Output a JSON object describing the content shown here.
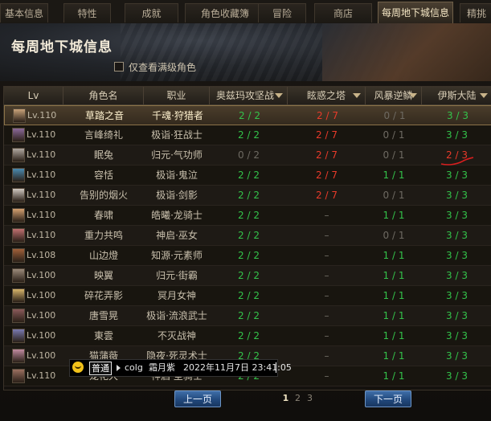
{
  "tabs": [
    {
      "label": "基本信息",
      "active": false
    },
    {
      "label": "特性",
      "active": false
    },
    {
      "label": "成就",
      "active": false
    },
    {
      "label": "角色收藏簿",
      "active": false
    },
    {
      "label": "冒险",
      "active": false
    },
    {
      "label": "商店",
      "active": false
    },
    {
      "label": "每周地下城信息",
      "active": true
    },
    {
      "label": "精挑",
      "active": false
    }
  ],
  "header": {
    "title": "每周地下城信息",
    "checkbox_label": "仅查看满级角色",
    "checkbox_checked": false
  },
  "table": {
    "columns": [
      "Lv",
      "角色名",
      "职业",
      "奥兹玛攻坚战",
      "眩惑之塔",
      "风暴逆鳞",
      "伊斯大陆"
    ],
    "sortable_columns": [
      3,
      4,
      5,
      6
    ],
    "rows": [
      {
        "lv": "Lv.110",
        "name": "草踏之音",
        "job": "千魂·狩猎者",
        "a": "2 / 2",
        "b": "2 / 7",
        "c": "0 / 1",
        "d": "3 / 3",
        "ac": "green",
        "bc": "red",
        "cc": "gray",
        "dc": "green",
        "selected": true
      },
      {
        "lv": "Lv.110",
        "name": "言峰绮礼",
        "job": "极诣·狂战士",
        "a": "2 / 2",
        "b": "2 / 7",
        "c": "0 / 1",
        "d": "3 / 3",
        "ac": "green",
        "bc": "red",
        "cc": "gray",
        "dc": "green",
        "selected": false
      },
      {
        "lv": "Lv.110",
        "name": "眠兔",
        "job": "归元·气功师",
        "a": "0 / 2",
        "b": "2 / 7",
        "c": "0 / 1",
        "d": "2 / 3",
        "ac": "gray",
        "bc": "red",
        "cc": "gray",
        "dc": "red",
        "selected": false
      },
      {
        "lv": "Lv.110",
        "name": "容恬",
        "job": "极诣·鬼泣",
        "a": "2 / 2",
        "b": "2 / 7",
        "c": "1 / 1",
        "d": "3 / 3",
        "ac": "green",
        "bc": "red",
        "cc": "green",
        "dc": "green",
        "selected": false
      },
      {
        "lv": "Lv.110",
        "name": "告别的烟火",
        "job": "极诣·剑影",
        "a": "2 / 2",
        "b": "2 / 7",
        "c": "0 / 1",
        "d": "3 / 3",
        "ac": "green",
        "bc": "red",
        "cc": "gray",
        "dc": "green",
        "selected": false
      },
      {
        "lv": "Lv.110",
        "name": "春啸",
        "job": "皓曦·龙骑士",
        "a": "2 / 2",
        "b": "–",
        "c": "1 / 1",
        "d": "3 / 3",
        "ac": "green",
        "bc": "gray",
        "cc": "green",
        "dc": "green",
        "selected": false
      },
      {
        "lv": "Lv.110",
        "name": "重力共鸣",
        "job": "神启·巫女",
        "a": "2 / 2",
        "b": "–",
        "c": "0 / 1",
        "d": "3 / 3",
        "ac": "green",
        "bc": "gray",
        "cc": "gray",
        "dc": "green",
        "selected": false
      },
      {
        "lv": "Lv.108",
        "name": "山边燈",
        "job": "知源·元素师",
        "a": "2 / 2",
        "b": "–",
        "c": "1 / 1",
        "d": "3 / 3",
        "ac": "green",
        "bc": "gray",
        "cc": "green",
        "dc": "green",
        "selected": false
      },
      {
        "lv": "Lv.100",
        "name": "映翼",
        "job": "归元·街霸",
        "a": "2 / 2",
        "b": "–",
        "c": "1 / 1",
        "d": "3 / 3",
        "ac": "green",
        "bc": "gray",
        "cc": "green",
        "dc": "green",
        "selected": false
      },
      {
        "lv": "Lv.100",
        "name": "碎花弄影",
        "job": "冥月女神",
        "a": "2 / 2",
        "b": "–",
        "c": "1 / 1",
        "d": "3 / 3",
        "ac": "green",
        "bc": "gray",
        "cc": "green",
        "dc": "green",
        "selected": false
      },
      {
        "lv": "Lv.100",
        "name": "唐雪晃",
        "job": "极诣·流浪武士",
        "a": "2 / 2",
        "b": "–",
        "c": "1 / 1",
        "d": "3 / 3",
        "ac": "green",
        "bc": "gray",
        "cc": "green",
        "dc": "green",
        "selected": false
      },
      {
        "lv": "Lv.100",
        "name": "東雲",
        "job": "不灭战神",
        "a": "2 / 2",
        "b": "–",
        "c": "1 / 1",
        "d": "3 / 3",
        "ac": "green",
        "bc": "gray",
        "cc": "green",
        "dc": "green",
        "selected": false
      },
      {
        "lv": "Lv.100",
        "name": "猫蒲薇",
        "job": "隐夜·死灵术士",
        "a": "2 / 2",
        "b": "–",
        "c": "1 / 1",
        "d": "3 / 3",
        "ac": "green",
        "bc": "gray",
        "cc": "green",
        "dc": "green",
        "selected": false
      },
      {
        "lv": "Lv.110",
        "name": "宠花大",
        "job": "神启·圣骑士",
        "a": "2 / 2",
        "b": "–",
        "c": "1 / 1",
        "d": "3 / 3",
        "ac": "green",
        "bc": "gray",
        "cc": "green",
        "dc": "green",
        "selected": false
      }
    ]
  },
  "avatar_colors": [
    "#c9a27a",
    "#8c6a9a",
    "#b0a8a0",
    "#4a8ab0",
    "#d0c8c0",
    "#d4a070",
    "#c07070",
    "#a0603a",
    "#9a8a7a",
    "#d6b46a",
    "#8a5a5a",
    "#7a7ab0",
    "#c08aa0",
    "#9a7060"
  ],
  "chat": {
    "channel": "普通",
    "segments": [
      "colg",
      "霜月紫",
      "2022年11月7日 23:41:05"
    ]
  },
  "pagination": {
    "prev_label": "上一页",
    "next_label": "下一页",
    "pages": [
      "1",
      "2",
      "3"
    ],
    "current": "1"
  },
  "colors": {
    "green": "#33c24a",
    "red": "#e83a2a",
    "gray": "#6e6a62",
    "selected_row": "#4a3d2b",
    "button": "#2b5590"
  }
}
